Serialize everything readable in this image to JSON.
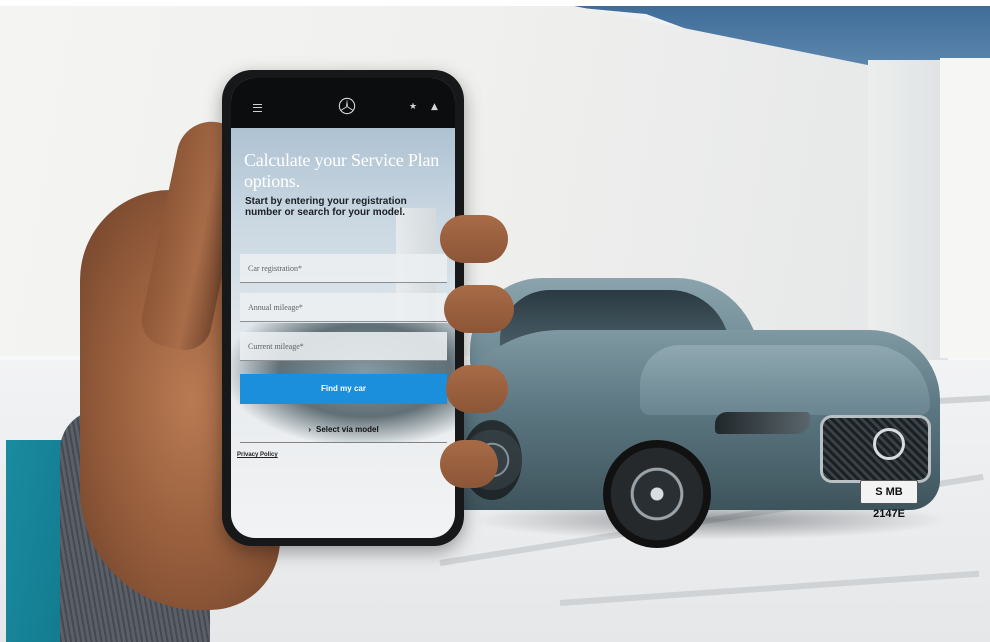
{
  "phone_app": {
    "header": {
      "menu_icon": "hamburger-menu-icon",
      "brand_icon": "three-pointed-star-logo-icon",
      "favorites_icon": "star-icon",
      "account_icon": "user-icon",
      "star_glyph": "★",
      "user_glyph": "▲"
    },
    "title": "Calculate your Service Plan options.",
    "subtitle": "Start by entering your registration number or search for your model.",
    "form": {
      "car_registration_placeholder": "Car registration*",
      "annual_mileage_placeholder": "Annual mileage*",
      "current_mileage_placeholder": "Current mileage*",
      "find_button_label": "Find my car",
      "select_via_model_label": "Select via model",
      "select_via_model_glyph": "›"
    },
    "privacy_label": "Privacy Policy"
  },
  "car": {
    "license_plate": "S MB 2147E"
  },
  "colors": {
    "primary_button": "#1c8fdc",
    "header_bg": "#0c0d0e",
    "car_paint": "#5b7680",
    "sleeve": "#1a8ba0"
  }
}
